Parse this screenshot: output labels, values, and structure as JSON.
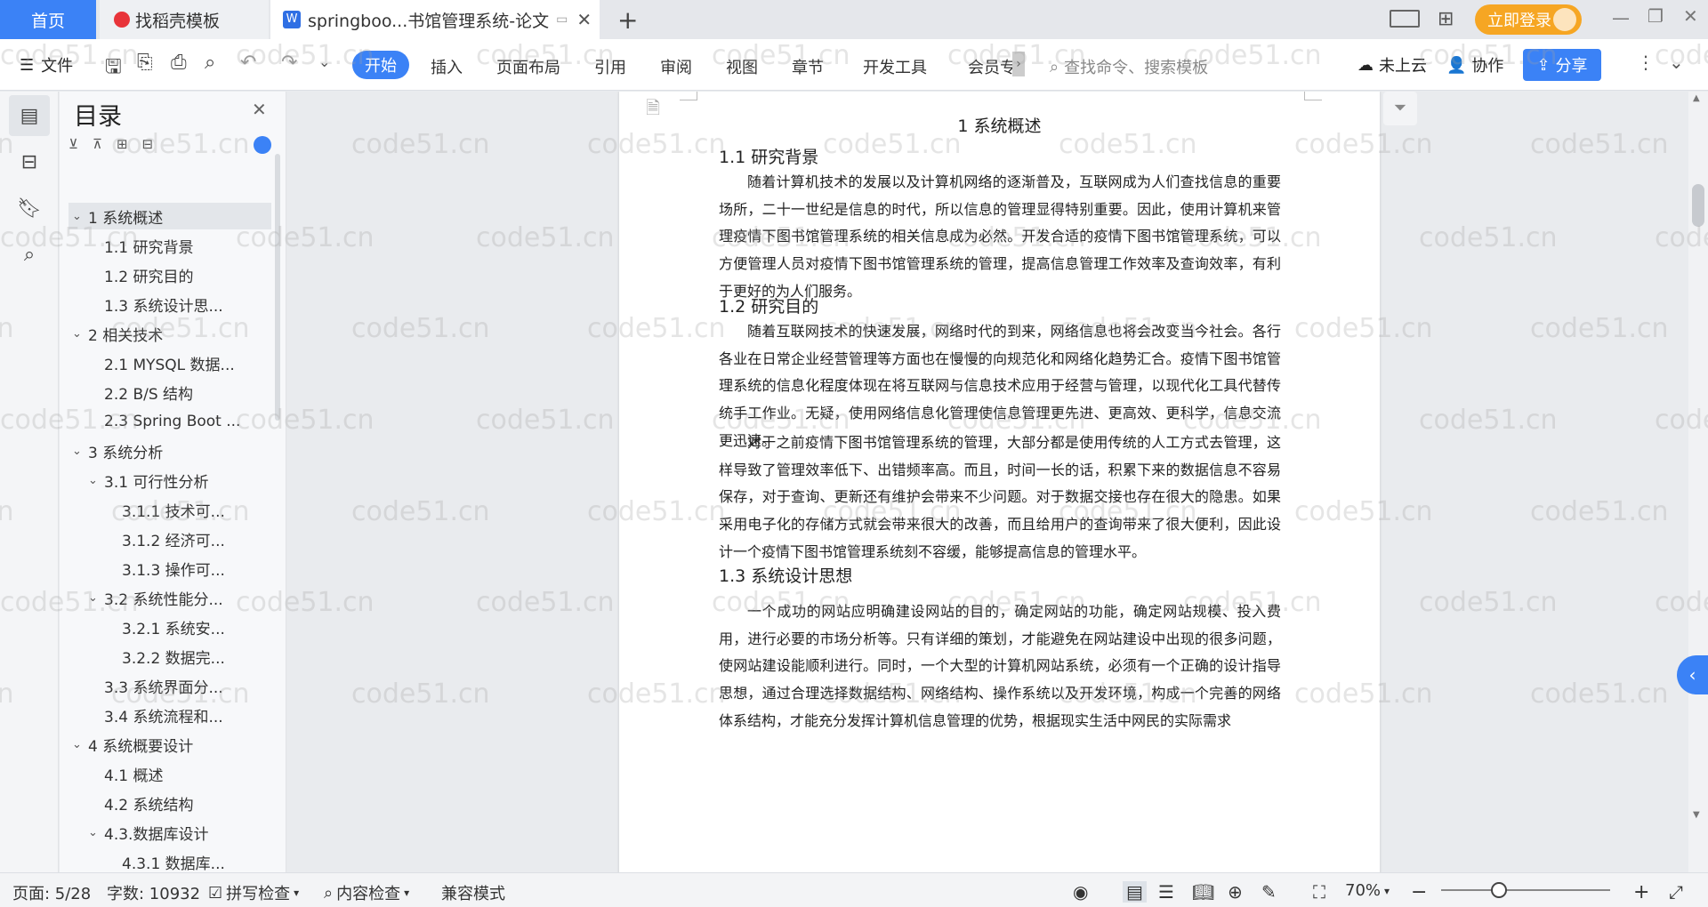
{
  "tabs": {
    "home": "首页",
    "template": "找稻壳模板",
    "document": "springboo...书馆管理系统-论文"
  },
  "titlebar": {
    "login": "立即登录"
  },
  "toolbar": {
    "file": "文件",
    "menus": [
      "开始",
      "插入",
      "页面布局",
      "引用",
      "审阅",
      "视图",
      "章节",
      "开发工具",
      "会员专"
    ],
    "search_placeholder": "查找命令、搜索模板",
    "cloud": "未上云",
    "collab": "协作",
    "share": "分享"
  },
  "toc": {
    "title": "目录",
    "items": [
      {
        "label": "1 系统概述",
        "level": 0,
        "caret": "open",
        "active": true
      },
      {
        "label": "1.1  研究背景",
        "level": 1
      },
      {
        "label": "1.2 研究目的",
        "level": 1
      },
      {
        "label": "1.3 系统设计思...",
        "level": 1
      },
      {
        "label": "2 相关技术",
        "level": 0,
        "caret": "open"
      },
      {
        "label": "2.1 MYSQL 数据...",
        "level": 1
      },
      {
        "label": "2.2 B/S 结构",
        "level": 1
      },
      {
        "label": "2.3 Spring Boot ...",
        "level": 1
      },
      {
        "label": "3 系统分析",
        "level": 0,
        "caret": "open"
      },
      {
        "label": "3.1 可行性分析",
        "level": 1,
        "caret": "open"
      },
      {
        "label": "3.1.1 技术可...",
        "level": 2
      },
      {
        "label": "3.1.2 经济可...",
        "level": 2
      },
      {
        "label": "3.1.3 操作可...",
        "level": 2
      },
      {
        "label": "3.2 系统性能分...",
        "level": 1,
        "caret": "open"
      },
      {
        "label": "3.2.1  系统安...",
        "level": 2
      },
      {
        "label": "3.2.2  数据完...",
        "level": 2
      },
      {
        "label": "3.3 系统界面分...",
        "level": 1
      },
      {
        "label": "3.4 系统流程和...",
        "level": 1
      },
      {
        "label": "4 系统概要设计",
        "level": 0,
        "caret": "open"
      },
      {
        "label": "4.1 概述",
        "level": 1
      },
      {
        "label": "4.2 系统结构",
        "level": 1
      },
      {
        "label": "4.3.数据库设计",
        "level": 1,
        "caret": "open"
      },
      {
        "label": "4.3.1 数据库...",
        "level": 2
      }
    ]
  },
  "document": {
    "chapter": "1 系统概述",
    "s1_title": "1.1  研究背景",
    "s1_para": "随着计算机技术的发展以及计算机网络的逐渐普及，互联网成为人们查找信息的重要场所，二十一世纪是信息的时代，所以信息的管理显得特别重要。因此，使用计算机来管理疫情下图书馆管理系统的相关信息成为必然。开发合适的疫情下图书馆管理系统，可以方便管理人员对疫情下图书馆管理系统的管理，提高信息管理工作效率及查询效率，有利于更好的为人们服务。",
    "s2_title": "1.2 研究目的",
    "s2_para1": "随着互联网技术的快速发展，网络时代的到来，网络信息也将会改变当今社会。各行各业在日常企业经营管理等方面也在慢慢的向规范化和网络化趋势汇合。疫情下图书馆管理系统的信息化程度体现在将互联网与信息技术应用于经营与管理，以现代化工具代替传统手工作业。无疑，使用网络信息化管理使信息管理更先进、更高效、更科学，信息交流更迅速。",
    "s2_para2": "对于之前疫情下图书馆管理系统的管理，大部分都是使用传统的人工方式去管理，这样导致了管理效率低下、出错频率高。而且，时间一长的话，积累下来的数据信息不容易保存，对于查询、更新还有维护会带来不少问题。对于数据交接也存在很大的隐患。如果采用电子化的存储方式就会带来很大的改善，而且给用户的查询带来了很大便利，因此设计一个疫情下图书馆管理系统刻不容缓，能够提高信息的管理水平。",
    "s3_title": "1.3 系统设计思想",
    "s3_para": "一个成功的网站应明确建设网站的目的，确定网站的功能，确定网站规模、投入费用，进行必要的市场分析等。只有详细的策划，才能避免在网站建设中出现的很多问题，使网站建设能顺利进行。同时，一个大型的计算机网站系统，必须有一个正确的设计指导思想，通过合理选择数据结构、网络结构、操作系统以及开发环境，构成一个完善的网络体系结构，才能充分发挥计算机信息管理的优势，根据现实生活中网民的实际需求"
  },
  "statusbar": {
    "page": "页面: 5/28",
    "words": "字数: 10932",
    "spell": "拼写检查",
    "content_check": "内容检查",
    "compat": "兼容模式",
    "zoom": "70%"
  },
  "watermark": "code51.cn"
}
